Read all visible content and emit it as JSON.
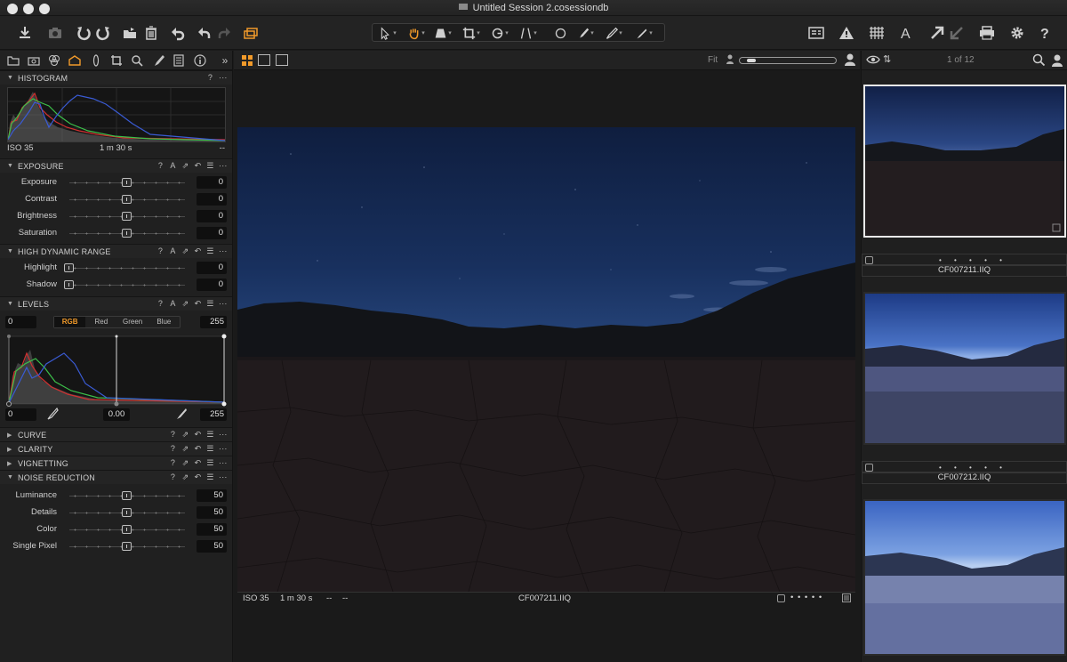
{
  "window": {
    "title": "Untitled Session 2.cosessiondb"
  },
  "toolbar": {
    "left_icons": [
      "import-icon",
      "camera-icon",
      "rotate-left-icon",
      "rotate-right-icon",
      "move-to-folder-icon",
      "trash-icon",
      "reset-icon",
      "undo-icon",
      "redo-icon",
      "variants-icon"
    ],
    "cursor_tools": [
      "select-cursor-icon",
      "pan-hand-icon",
      "keystone-icon",
      "crop-icon",
      "rotate-icon",
      "straighten-icon",
      "mask-circle-icon",
      "brush-icon",
      "picker-icon",
      "color-picker-icon"
    ],
    "right_icons": [
      "viewer-compare-icon",
      "warning-icon",
      "grid-icon",
      "text-overlay-icon",
      "arrow-export-icon",
      "print-icon",
      "settings-icon",
      "help-icon"
    ],
    "accent": "#f19a2a"
  },
  "tool_tabs": [
    "folder-icon",
    "camera-icon",
    "color-icon",
    "exposure-icon",
    "lens-icon",
    "crop-icon",
    "details-icon",
    "brush-icon",
    "metadata-icon",
    "info-icon",
    "more-icon"
  ],
  "histogram": {
    "title": "HISTOGRAM",
    "help": "?",
    "menu": "···",
    "iso": "ISO 35",
    "shutter": "1 m 30 s",
    "aperture": "--"
  },
  "exposure": {
    "title": "EXPOSURE",
    "sliders": [
      {
        "label": "Exposure",
        "value": "0"
      },
      {
        "label": "Contrast",
        "value": "0"
      },
      {
        "label": "Brightness",
        "value": "0"
      },
      {
        "label": "Saturation",
        "value": "0"
      }
    ]
  },
  "hdr": {
    "title": "HIGH DYNAMIC RANGE",
    "sliders": [
      {
        "label": "Highlight",
        "value": "0"
      },
      {
        "label": "Shadow",
        "value": "0"
      }
    ]
  },
  "levels": {
    "title": "LEVELS",
    "in_low": "0",
    "in_high": "255",
    "channels": [
      "RGB",
      "Red",
      "Green",
      "Blue"
    ],
    "out_low": "0",
    "mid": "0.00",
    "out_high": "255"
  },
  "collapsed_sections": [
    "CURVE",
    "CLARITY",
    "VIGNETTING"
  ],
  "noise": {
    "title": "NOISE REDUCTION",
    "sliders": [
      {
        "label": "Luminance",
        "value": "50"
      },
      {
        "label": "Details",
        "value": "50"
      },
      {
        "label": "Color",
        "value": "50"
      },
      {
        "label": "Single Pixel",
        "value": "50"
      }
    ]
  },
  "viewer": {
    "zoom_label": "Fit",
    "iso": "ISO 35",
    "shutter": "1 m 30 s",
    "aperture": "--",
    "focal": "--",
    "filename": "CF007211.IIQ",
    "stars": "• • • • •"
  },
  "browser": {
    "counter": "1 of 12",
    "thumbs": [
      {
        "name": "CF007211.IIQ",
        "stars": "• • • • •"
      },
      {
        "name": "CF007212.IIQ",
        "stars": "• • • • •"
      },
      {
        "name": "",
        "stars": ""
      }
    ]
  }
}
